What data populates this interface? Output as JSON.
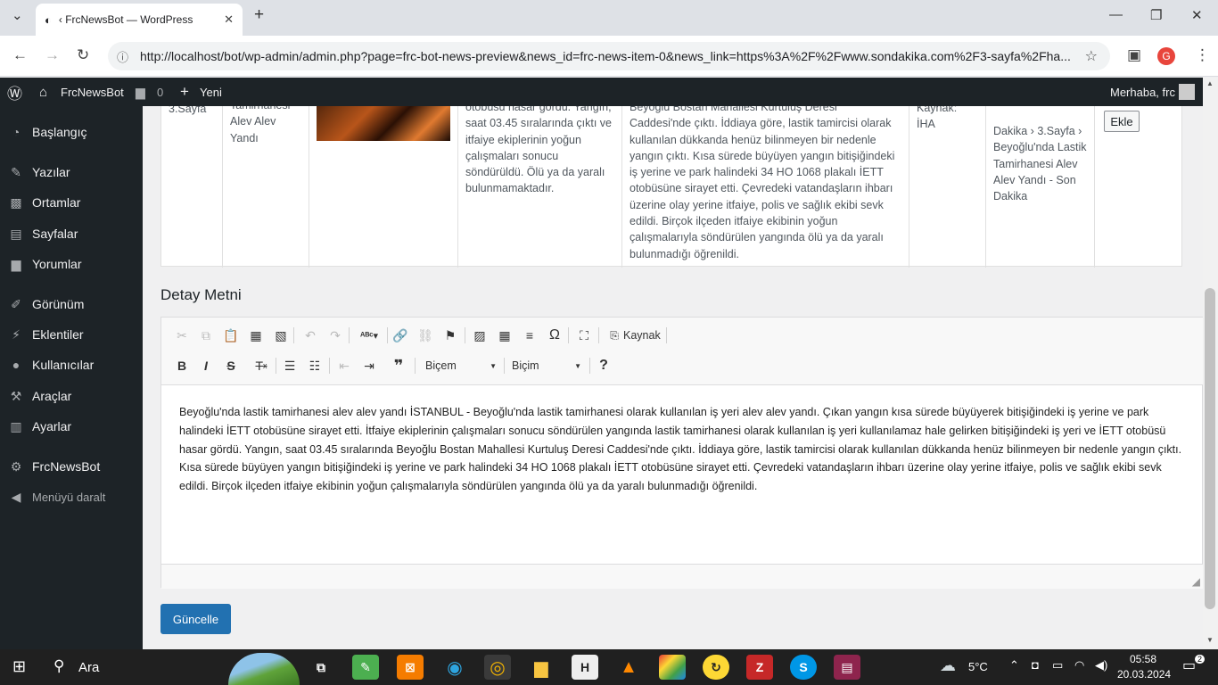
{
  "browser": {
    "tab_title": "‹ FrcNewsBot — WordPress",
    "url": "http://localhost/bot/wp-admin/admin.php?page=frc-bot-news-preview&news_id=frc-news-item-0&news_link=https%3A%2F%2Fwww.sondakika.com%2F3-sayfa%2Fha...",
    "profile_initial": "G"
  },
  "adminbar": {
    "site": "FrcNewsBot",
    "comments": "0",
    "new": "Yeni",
    "greeting": "Merhaba, frc"
  },
  "sidebar": {
    "items": [
      {
        "label": "Başlangıç",
        "icon": "dashboard-icon"
      },
      {
        "label": "Yazılar",
        "icon": "pin-icon"
      },
      {
        "label": "Ortamlar",
        "icon": "media-icon"
      },
      {
        "label": "Sayfalar",
        "icon": "page-icon"
      },
      {
        "label": "Yorumlar",
        "icon": "comment-icon"
      },
      {
        "label": "Görünüm",
        "icon": "brush-icon"
      },
      {
        "label": "Eklentiler",
        "icon": "plugin-icon"
      },
      {
        "label": "Kullanıcılar",
        "icon": "user-icon"
      },
      {
        "label": "Araçlar",
        "icon": "wrench-icon"
      },
      {
        "label": "Ayarlar",
        "icon": "settings-icon"
      },
      {
        "label": "FrcNewsBot",
        "icon": "gear-icon"
      },
      {
        "label": "Menüyü daralt",
        "icon": "collapse-icon"
      }
    ]
  },
  "table_row": {
    "category": "3.Sayfa",
    "title": "Tamirhanesi Alev Alev Yandı",
    "summary": "otobüsü hasar gördü. Yangın, saat 03.45 sıralarında çıktı ve itfaiye ekiplerinin yoğun çalışmaları sonucu söndürüldü. Ölü ya da yaralı bulunmamaktadır.",
    "detail": "Beyoğlu Bostan Mahallesi Kurtuluş Deresi Caddesi'nde çıktı. İddiaya göre, lastik tamircisi olarak kullanılan dükkanda henüz bilinmeyen bir nedenle yangın çıktı. Kısa sürede büyüyen yangın bitişiğindeki iş yerine ve park halindeki 34 HO 1068 plakalı İETT otobüsüne sirayet etti. Çevredeki vatandaşların ihbarı üzerine olay yerine itfaiye, polis ve sağlık ekibi sevk edildi. Birçok ilçeden itfaiye ekibinin yoğun çalışmalarıyla söndürülen yangında ölü ya da yaralı bulunmadığı öğrenildi.",
    "source": "Kaynak: İHA",
    "breadcrumb": "Dakika › 3.Sayfa › Beyoğlu'nda Lastik Tamirhanesi Alev Alev Yandı - Son Dakika",
    "add_button": "Ekle"
  },
  "detail": {
    "heading": "Detay Metni",
    "source_button": "Kaynak",
    "format1": "Biçem",
    "format2": "Biçim",
    "help": "?",
    "body": "Beyoğlu'nda lastik tamirhanesi alev alev yandı İSTANBUL - Beyoğlu'nda lastik tamirhanesi olarak kullanılan iş yeri alev alev yandı. Çıkan yangın kısa sürede büyüyerek bitişiğindeki iş yerine ve park halindeki İETT otobüsüne sirayet etti. İtfaiye ekiplerinin çalışmaları sonucu söndürülen yangında lastik tamirhanesi olarak kullanılan iş yeri kullanılamaz hale gelirken bitişiğindeki iş yeri ve İETT otobüsü hasar gördü. Yangın, saat 03.45 sıralarında Beyoğlu Bostan Mahallesi Kurtuluş Deresi Caddesi'nde çıktı. İddiaya göre, lastik tamircisi olarak kullanılan dükkanda henüz bilinmeyen bir nedenle yangın çıktı. Kısa sürede büyüyen yangın bitişiğindeki iş yerine ve park halindeki 34 HO 1068 plakalı İETT otobüsüne sirayet etti. Çevredeki vatandaşların ihbarı üzerine olay yerine itfaiye, polis ve sağlık ekibi sevk edildi. Birçok ilçeden itfaiye ekibinin yoğun çalışmalarıyla söndürülen yangında ölü ya da yaralı bulunmadığı öğrenildi.",
    "update_button": "Güncelle"
  },
  "taskbar": {
    "search": "Ara",
    "weather": "5°C",
    "time": "05:58",
    "date": "20.03.2024",
    "notifications": "2"
  },
  "colors": {
    "wp_blue": "#2271b1",
    "admin_dark": "#1d2327"
  }
}
